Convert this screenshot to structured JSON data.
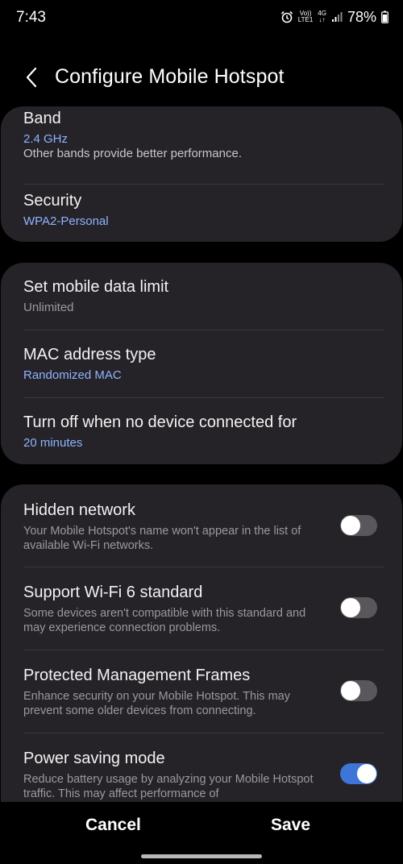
{
  "status_bar": {
    "time": "7:43",
    "volte": "Vo))",
    "lte": "LTE1",
    "network": "4G",
    "battery": "78%"
  },
  "header": {
    "title": "Configure Mobile Hotspot"
  },
  "card1": {
    "band": {
      "title": "Band",
      "value": "2.4 GHz",
      "note": "Other bands provide better performance."
    },
    "security": {
      "title": "Security",
      "value": "WPA2-Personal"
    }
  },
  "card2": {
    "data_limit": {
      "title": "Set mobile data limit",
      "value": "Unlimited"
    },
    "mac": {
      "title": "MAC address type",
      "value": "Randomized MAC"
    },
    "turn_off": {
      "title": "Turn off when no device connected for",
      "value": "20 minutes"
    }
  },
  "card3": {
    "hidden": {
      "title": "Hidden network",
      "desc": "Your Mobile Hotspot's name won't appear in the list of available Wi-Fi networks.",
      "enabled": false
    },
    "wifi6": {
      "title": "Support Wi-Fi 6 standard",
      "desc": "Some devices aren't compatible with this standard and may experience connection problems.",
      "enabled": false
    },
    "pmf": {
      "title": "Protected Management Frames",
      "desc": "Enhance security on your Mobile Hotspot. This may prevent some older devices from connecting.",
      "enabled": false
    },
    "power": {
      "title": "Power saving mode",
      "desc": "Reduce battery usage by analyzing your Mobile Hotspot traffic. This may affect performance of",
      "enabled": true
    }
  },
  "footer": {
    "cancel": "Cancel",
    "save": "Save"
  },
  "colors": {
    "background": "#000000",
    "card": "#252228",
    "accent_value": "#8fb4ff",
    "toggle_on": "#3e75d6",
    "toggle_off": "#5a575c"
  },
  "icons": [
    "alarm-icon",
    "signal-icon",
    "battery-icon",
    "back-arrow-icon"
  ]
}
